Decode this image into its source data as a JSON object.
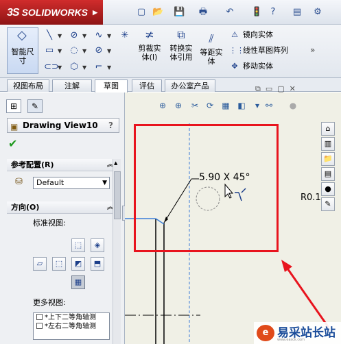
{
  "app": {
    "logo_text": "SOLIDWORKS",
    "logo_prefix": "3S",
    "logo_arrow": "▶"
  },
  "quick_access": [
    {
      "name": "new-document-icon",
      "glyph": "▢"
    },
    {
      "name": "open-folder-icon",
      "glyph": "📂"
    },
    {
      "name": "save-icon",
      "glyph": "💾"
    },
    {
      "name": "print-icon",
      "glyph": "🖶"
    },
    {
      "name": "undo-icon",
      "glyph": "↶"
    },
    {
      "name": "rebuild-icon",
      "glyph": "🚦"
    },
    {
      "name": "help-icon",
      "glyph": "?"
    },
    {
      "name": "file-properties-icon",
      "glyph": "▤"
    },
    {
      "name": "options-icon",
      "glyph": "⚙"
    }
  ],
  "ribbon": {
    "smart_dimension": {
      "label": "智能尺\n寸",
      "icon": "smart-dimension-icon"
    },
    "sketch_tools": [
      {
        "name": "line-icon",
        "glyph": "╲"
      },
      {
        "name": "circle-icon",
        "glyph": "⊘"
      },
      {
        "name": "spline-icon",
        "glyph": "∿"
      },
      {
        "name": "point-icon",
        "glyph": "✳"
      },
      {
        "name": "rectangle-icon",
        "glyph": "▭"
      },
      {
        "name": "polygon-circle-icon",
        "glyph": "◌"
      },
      {
        "name": "ellipse-icon",
        "glyph": "⊘"
      },
      {
        "name": "slot-icon",
        "glyph": "⊂⊃"
      },
      {
        "name": "polygon-icon",
        "glyph": "⬡"
      },
      {
        "name": "fillet-icon",
        "glyph": "⌐"
      }
    ],
    "trim": {
      "label": "剪裁实\n体(I)",
      "icon": "trim-icon"
    },
    "convert": {
      "label": "转换实\n体引用",
      "icon": "convert-entities-icon"
    },
    "offset": {
      "label": "等距实\n体",
      "icon": "offset-entities-icon"
    },
    "list": [
      {
        "label": "镜向实体",
        "icon": "mirror-icon",
        "glyph": "⚠"
      },
      {
        "label": "线性草图阵列",
        "icon": "linear-pattern-icon",
        "glyph": "⋮⋮"
      },
      {
        "label": "移动实体",
        "icon": "move-entities-icon",
        "glyph": "✥"
      }
    ],
    "more_chevron": "»"
  },
  "tabs": [
    {
      "label": "视图布局",
      "active": false
    },
    {
      "label": "注解",
      "active": false
    },
    {
      "label": "草图",
      "active": true
    },
    {
      "label": "评估",
      "active": false
    },
    {
      "label": "办公室产品",
      "active": false
    }
  ],
  "property_manager": {
    "title": "Drawing View10",
    "help": "?",
    "ok": "✔",
    "ref_config_label": "参考配置(R)",
    "config_value": "Default",
    "orientation_label": "方向(O)",
    "standard_views_label": "标准视图:",
    "more_views_label": "更多视图:",
    "more_views": [
      "*上下二等角轴测",
      "*左右二等角轴测"
    ]
  },
  "drawing": {
    "dimension_text": "5.90 X 45°",
    "ro_text": "R0.1"
  },
  "watermark": {
    "text": "易采站长站",
    "sub": "www.easck.com"
  },
  "colors": {
    "accent_red": "#e8141e",
    "sketch_blue": "#3b7dd8"
  }
}
